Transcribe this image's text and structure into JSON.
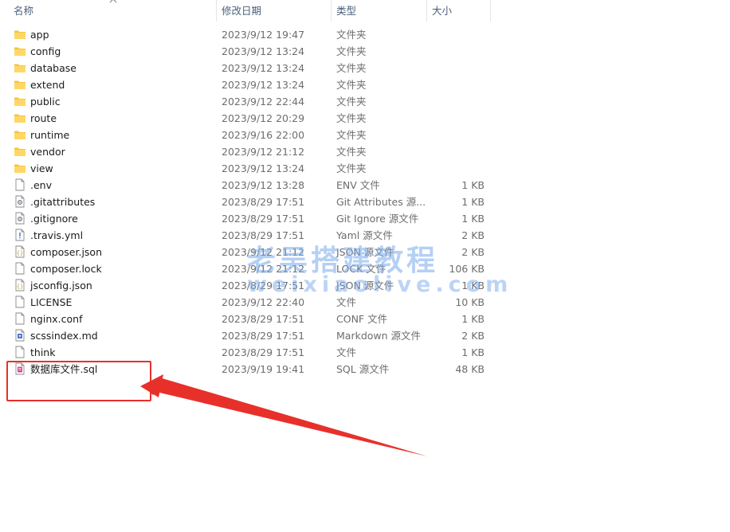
{
  "columns": {
    "name": "名称",
    "modified": "修改日期",
    "type": "类型",
    "size": "大小"
  },
  "files": [
    {
      "name": "app",
      "modified": "2023/9/12 19:47",
      "type": "文件夹",
      "size": "",
      "icon": "folder-icon"
    },
    {
      "name": "config",
      "modified": "2023/9/12 13:24",
      "type": "文件夹",
      "size": "",
      "icon": "folder-icon"
    },
    {
      "name": "database",
      "modified": "2023/9/12 13:24",
      "type": "文件夹",
      "size": "",
      "icon": "folder-icon"
    },
    {
      "name": "extend",
      "modified": "2023/9/12 13:24",
      "type": "文件夹",
      "size": "",
      "icon": "folder-icon"
    },
    {
      "name": "public",
      "modified": "2023/9/12 22:44",
      "type": "文件夹",
      "size": "",
      "icon": "folder-icon"
    },
    {
      "name": "route",
      "modified": "2023/9/12 20:29",
      "type": "文件夹",
      "size": "",
      "icon": "folder-icon"
    },
    {
      "name": "runtime",
      "modified": "2023/9/16 22:00",
      "type": "文件夹",
      "size": "",
      "icon": "folder-icon"
    },
    {
      "name": "vendor",
      "modified": "2023/9/12 21:12",
      "type": "文件夹",
      "size": "",
      "icon": "folder-icon"
    },
    {
      "name": "view",
      "modified": "2023/9/12 13:24",
      "type": "文件夹",
      "size": "",
      "icon": "folder-icon"
    },
    {
      "name": ".env",
      "modified": "2023/9/12 13:28",
      "type": "ENV 文件",
      "size": "1 KB",
      "icon": "file-icon"
    },
    {
      "name": ".gitattributes",
      "modified": "2023/8/29 17:51",
      "type": "Git Attributes 源...",
      "size": "1 KB",
      "icon": "gear-file-icon"
    },
    {
      "name": ".gitignore",
      "modified": "2023/8/29 17:51",
      "type": "Git Ignore 源文件",
      "size": "1 KB",
      "icon": "gear-file-icon"
    },
    {
      "name": ".travis.yml",
      "modified": "2023/8/29 17:51",
      "type": "Yaml 源文件",
      "size": "2 KB",
      "icon": "exclaim-file-icon"
    },
    {
      "name": "composer.json",
      "modified": "2023/9/12 21:12",
      "type": "JSON 源文件",
      "size": "2 KB",
      "icon": "braces-file-icon"
    },
    {
      "name": "composer.lock",
      "modified": "2023/9/12 21:12",
      "type": "LOCK 文件",
      "size": "106 KB",
      "icon": "file-icon"
    },
    {
      "name": "jsconfig.json",
      "modified": "2023/8/29 17:51",
      "type": "JSON 源文件",
      "size": "1 KB",
      "icon": "braces-file-icon"
    },
    {
      "name": "LICENSE",
      "modified": "2023/9/12 22:40",
      "type": "文件",
      "size": "10 KB",
      "icon": "file-icon"
    },
    {
      "name": "nginx.conf",
      "modified": "2023/8/29 17:51",
      "type": "CONF 文件",
      "size": "1 KB",
      "icon": "file-icon"
    },
    {
      "name": "scssindex.md",
      "modified": "2023/8/29 17:51",
      "type": "Markdown 源文件",
      "size": "2 KB",
      "icon": "markdown-file-icon"
    },
    {
      "name": "think",
      "modified": "2023/8/29 17:51",
      "type": "文件",
      "size": "1 KB",
      "icon": "file-icon"
    },
    {
      "name": "数据库文件.sql",
      "modified": "2023/9/19 19:41",
      "type": "SQL 源文件",
      "size": "48 KB",
      "icon": "sql-file-icon"
    }
  ],
  "watermark": {
    "line1": "老吴搭建教程",
    "line2": "weixiaolive.com"
  },
  "colors": {
    "folder": "#f5c542",
    "annotation": "#e8302a",
    "header_text": "#4c607a"
  }
}
